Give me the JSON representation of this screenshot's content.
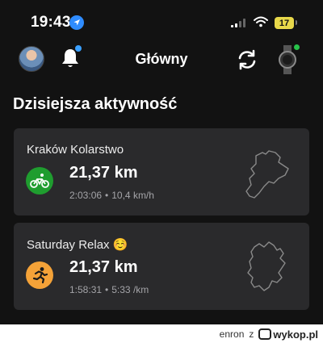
{
  "status_bar": {
    "time": "19:43",
    "battery_level": "17",
    "icons": [
      "location-arrow-icon",
      "cellular-signal-icon",
      "wifi-icon",
      "battery-icon"
    ]
  },
  "header": {
    "title": "Główny",
    "icons": [
      "avatar",
      "bell-icon",
      "sync-icon",
      "watch-icon"
    ]
  },
  "section": {
    "title": "Dzisiejsza aktywność"
  },
  "activities": [
    {
      "name": "Kraków Kolarstwo",
      "icon": "bike-icon",
      "icon_color": "#1f9d2f",
      "distance": "21,37 km",
      "duration": "2:03:06",
      "separator": "•",
      "pace": "10,4 km/h"
    },
    {
      "name": "Saturday Relax ☺️",
      "icon": "run-icon",
      "icon_color": "#f4a238",
      "distance": "21,37 km",
      "duration": "1:58:31",
      "separator": "•",
      "pace": "5:33 /km"
    }
  ],
  "watermark": {
    "user": "enron",
    "tag": "z",
    "site": "wykop.pl"
  }
}
